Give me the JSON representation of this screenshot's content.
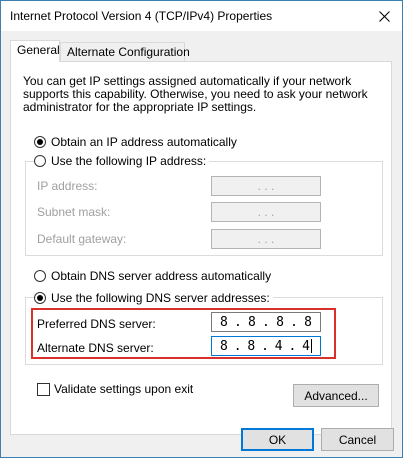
{
  "window": {
    "title": "Internet Protocol Version 4 (TCP/IPv4) Properties",
    "close_glyph": "close-icon"
  },
  "tabs": [
    {
      "label": "General",
      "active": true
    },
    {
      "label": "Alternate Configuration",
      "active": false
    }
  ],
  "description": "You can get IP settings assigned automatically if your network supports this capability. Otherwise, you need to ask your network administrator for the appropriate IP settings.",
  "ip_section": {
    "auto_label": "Obtain an IP address automatically",
    "auto_selected": true,
    "manual_label": "Use the following IP address:",
    "manual_selected": false,
    "fields": [
      {
        "label": "IP address:",
        "value": ".     .     ."
      },
      {
        "label": "Subnet mask:",
        "value": ".     .     ."
      },
      {
        "label": "Default gateway:",
        "value": ".     .     ."
      }
    ]
  },
  "dns_section": {
    "auto_label": "Obtain DNS server address automatically",
    "auto_selected": false,
    "manual_label": "Use the following DNS server addresses:",
    "manual_selected": true,
    "preferred": {
      "label": "Preferred DNS server:",
      "octets": [
        "8",
        "8",
        "8",
        "8"
      ]
    },
    "alternate": {
      "label": "Alternate DNS server:",
      "octets": [
        "8",
        "8",
        "4",
        "4"
      ]
    }
  },
  "validate": {
    "label": "Validate settings upon exit",
    "checked": false
  },
  "buttons": {
    "advanced": "Advanced...",
    "ok": "OK",
    "cancel": "Cancel"
  },
  "colors": {
    "highlight": "#d9302c",
    "focus": "#0078d7"
  }
}
